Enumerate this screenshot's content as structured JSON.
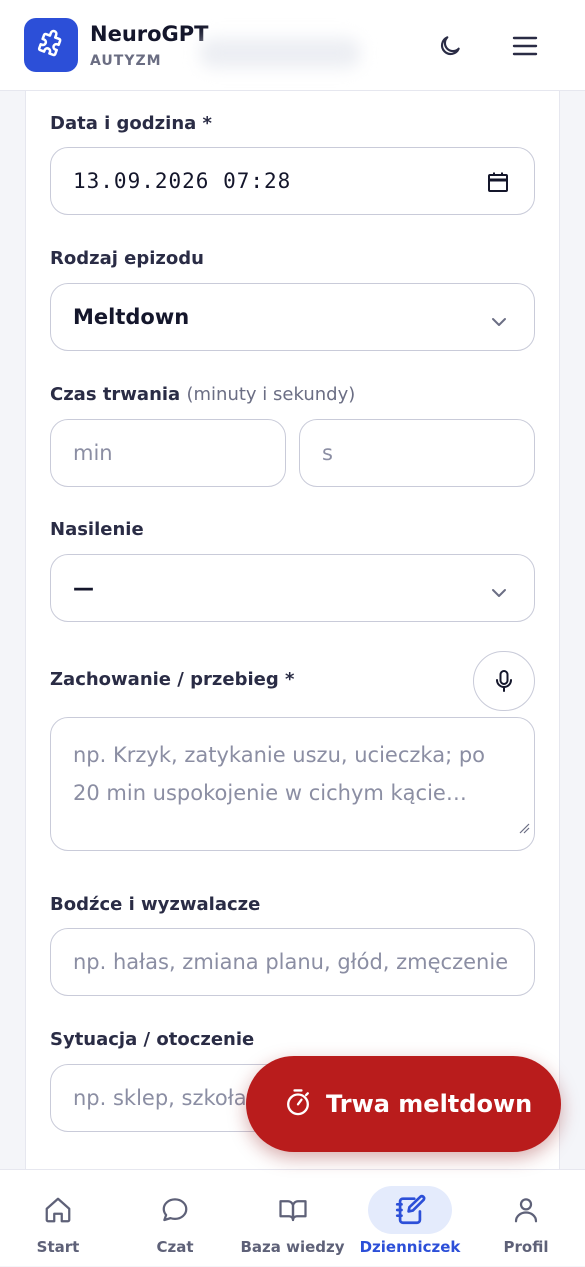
{
  "header": {
    "title": "NeuroGPT",
    "subtitle": "AUTYZM",
    "logo_icon": "puzzle-icon",
    "theme_icon": "moon-icon",
    "menu_icon": "hamburger-menu-icon"
  },
  "form": {
    "datetime": {
      "label": "Data i godzina *",
      "value": "13.09.2026 07:28"
    },
    "episode_type": {
      "label": "Rodzaj epizodu",
      "value": "Meltdown"
    },
    "duration": {
      "label": "Czas trwania",
      "hint": "(minuty i sekundy)",
      "min_placeholder": "min",
      "sec_placeholder": "s"
    },
    "intensity": {
      "label": "Nasilenie",
      "value": "—"
    },
    "behavior": {
      "label": "Zachowanie / przebieg *",
      "placeholder": "np. Krzyk, zatykanie uszu, ucieczka; po 20 min uspokojenie w cichym kącie…"
    },
    "triggers": {
      "label": "Bodźce i wyzwalacze",
      "placeholder": "np. hałas, zmiana planu, głód, zmęczenie"
    },
    "situation": {
      "label": "Sytuacja / otoczenie",
      "placeholder": "np. sklep, szkoła, dom"
    }
  },
  "fab": {
    "label": "Trwa meltdown",
    "icon": "stopwatch-icon"
  },
  "nav": [
    {
      "label": "Start",
      "icon": "home-icon"
    },
    {
      "label": "Czat",
      "icon": "chat-bubble-icon"
    },
    {
      "label": "Baza wiedzy",
      "icon": "book-icon"
    },
    {
      "label": "Dzienniczek",
      "icon": "journal-edit-icon",
      "active": true
    },
    {
      "label": "Profil",
      "icon": "user-icon"
    }
  ],
  "colors": {
    "brand": "#2c4fd8",
    "alert": "#b91c1c",
    "nav_active_bg": "#e4ebfc"
  }
}
